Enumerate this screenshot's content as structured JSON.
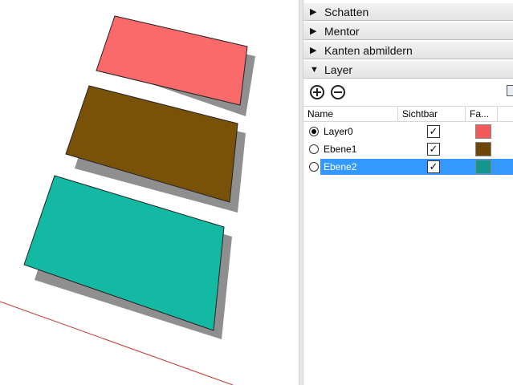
{
  "panel": {
    "trays": [
      {
        "label": "Schatten",
        "expanded": false
      },
      {
        "label": "Mentor",
        "expanded": false
      },
      {
        "label": "Kanten abmildern",
        "expanded": false
      },
      {
        "label": "Layer",
        "expanded": true
      }
    ],
    "arrow_collapsed": "▶",
    "arrow_expanded": "▼"
  },
  "layers": {
    "columns": {
      "name": "Name",
      "visible": "Sichtbar",
      "color": "Fa..."
    },
    "check_glyph": "✓",
    "rows": [
      {
        "name": "Layer0",
        "active": true,
        "visible": true,
        "color": "#f25a5a",
        "selected": false
      },
      {
        "name": "Ebene1",
        "active": false,
        "visible": true,
        "color": "#6e4708",
        "selected": false
      },
      {
        "name": "Ebene2",
        "active": false,
        "visible": true,
        "color": "#12978a",
        "selected": true
      }
    ]
  },
  "scene": {
    "faces": [
      {
        "color": "#fa6a6a"
      },
      {
        "color": "#7a5108"
      },
      {
        "color": "#13b9a2"
      }
    ],
    "shadow_color": "#8f8f8f",
    "axis_color": "#c0392b"
  }
}
